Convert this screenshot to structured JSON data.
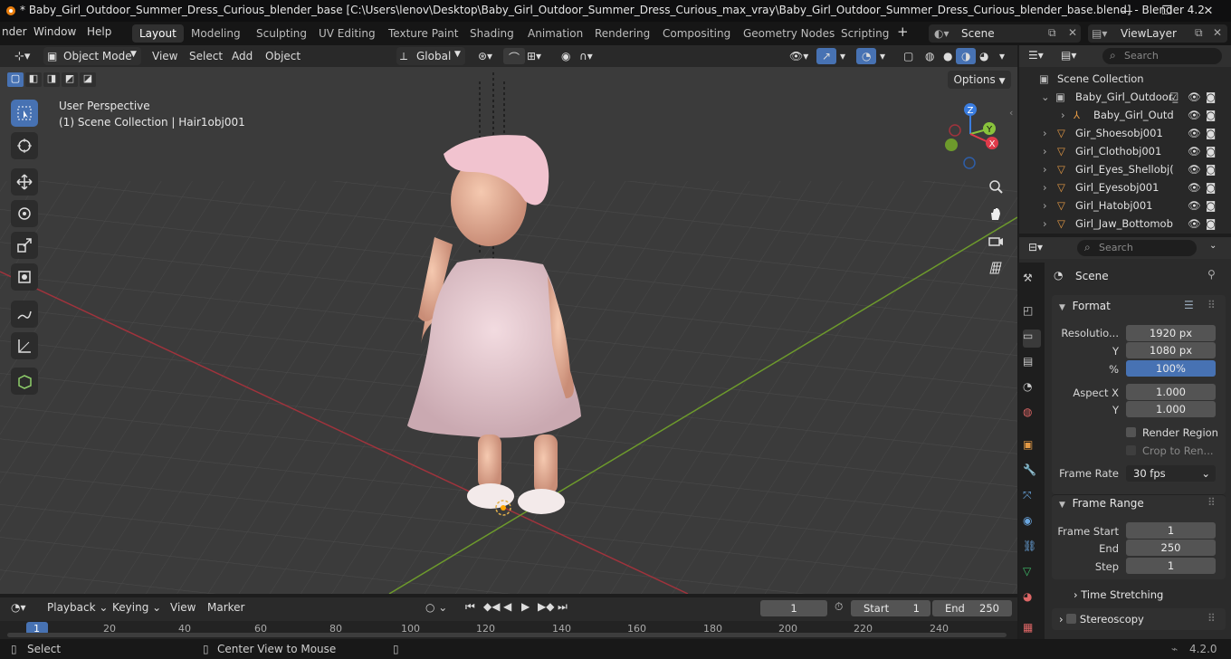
{
  "titlebar": {
    "title": "* Baby_Girl_Outdoor_Summer_Dress_Curious_blender_base [C:\\Users\\lenov\\Desktop\\Baby_Girl_Outdoor_Summer_Dress_Curious_max_vray\\Baby_Girl_Outdoor_Summer_Dress_Curious_blender_base.blend] - Blender 4.2",
    "minimize": "—",
    "maximize": "❐",
    "close": "✕"
  },
  "menubar": {
    "menus": [
      "nder",
      "Window",
      "Help"
    ],
    "workspaces": [
      "Layout",
      "Modeling",
      "Sculpting",
      "UV Editing",
      "Texture Paint",
      "Shading",
      "Animation",
      "Rendering",
      "Compositing",
      "Geometry Nodes",
      "Scripting"
    ],
    "add_tab": "+",
    "scene": "Scene",
    "view_layer": "ViewLayer"
  },
  "viewport_header": {
    "mode": "Object Mode",
    "menus": [
      "View",
      "Select",
      "Add",
      "Object"
    ],
    "orientation": "Global"
  },
  "viewport": {
    "options": "Options",
    "perspective": "User Perspective",
    "collection": "(1) Scene Collection | Hair1obj001"
  },
  "gizmo": {
    "x": "X",
    "y": "Y",
    "z": "Z"
  },
  "outliner": {
    "search_placeholder": "Search",
    "root": "Scene Collection",
    "rows": [
      {
        "name": "Baby_Girl_Outdoor_"
      },
      {
        "name": "Baby_Girl_Outd"
      },
      {
        "name": "Gir_Shoesobj001"
      },
      {
        "name": "Girl_Clothobj001"
      },
      {
        "name": "Girl_Eyes_Shellobj("
      },
      {
        "name": "Girl_Eyesobj001"
      },
      {
        "name": "Girl_Hatobj001"
      },
      {
        "name": "Girl_Jaw_Bottomob"
      }
    ]
  },
  "properties": {
    "search_placeholder": "Search",
    "context": "Scene",
    "format": {
      "title": "Format",
      "res_x_label": "Resolutio...",
      "res_x": "1920 px",
      "res_y_label": "Y",
      "res_y": "1080 px",
      "pct_label": "%",
      "pct": "100%",
      "aspect_x_label": "Aspect X",
      "aspect_x": "1.000",
      "aspect_y_label": "Y",
      "aspect_y": "1.000",
      "render_region": "Render Region",
      "crop": "Crop to Ren...",
      "frame_rate_label": "Frame Rate",
      "frame_rate": "30 fps"
    },
    "frame_range": {
      "title": "Frame Range",
      "start_label": "Frame Start",
      "start": "1",
      "end_label": "End",
      "end": "250",
      "step_label": "Step",
      "step": "1"
    },
    "time_stretching": "Time Stretching",
    "stereoscopy": "Stereoscopy"
  },
  "timeline": {
    "menus": [
      "Playback",
      "Keying",
      "View",
      "Marker"
    ],
    "current_frame": "1",
    "start_label": "Start",
    "start": "1",
    "end_label": "End",
    "end": "250",
    "ticks": [
      "1",
      "20",
      "40",
      "60",
      "80",
      "100",
      "120",
      "140",
      "160",
      "180",
      "200",
      "220",
      "240"
    ]
  },
  "statusbar": {
    "select": "Select",
    "center_view": "Center View to Mouse",
    "version": "4.2.0"
  },
  "colors": {
    "accent": "#4772b3",
    "x_axis": "#e03a4a",
    "y_axis": "#89c33c",
    "z_axis": "#3a7de0"
  }
}
